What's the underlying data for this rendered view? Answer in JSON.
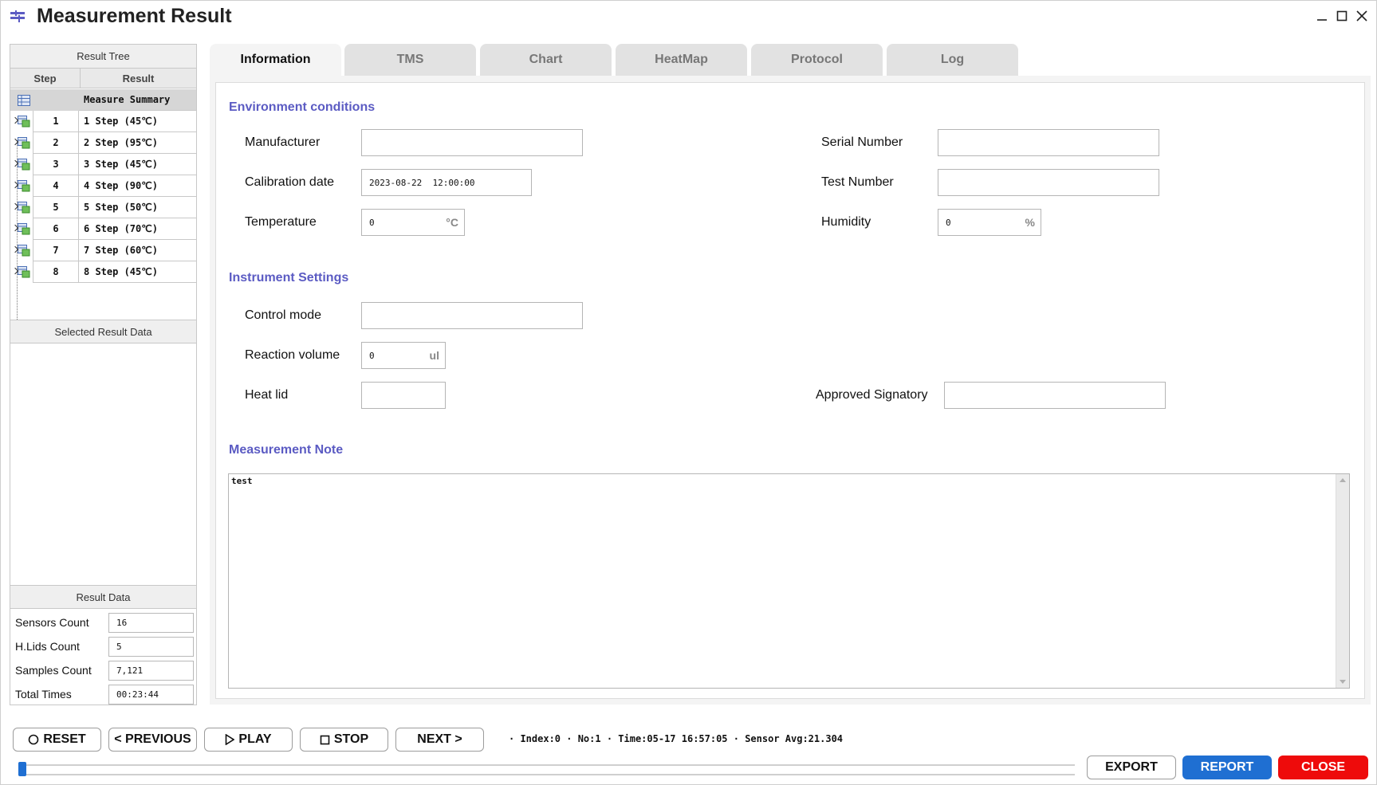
{
  "window": {
    "title": "Measurement Result"
  },
  "left_panel": {
    "result_tree_title": "Result Tree",
    "columns": {
      "step": "Step",
      "result": "Result"
    },
    "summary_label": "Measure Summary",
    "rows": [
      {
        "step": "1",
        "result": "1 Step (45℃)"
      },
      {
        "step": "2",
        "result": "2 Step (95℃)"
      },
      {
        "step": "3",
        "result": "3 Step (45℃)"
      },
      {
        "step": "4",
        "result": "4 Step (90℃)"
      },
      {
        "step": "5",
        "result": "5 Step (50℃)"
      },
      {
        "step": "6",
        "result": "6 Step (70℃)"
      },
      {
        "step": "7",
        "result": "7 Step (60℃)"
      },
      {
        "step": "8",
        "result": "8 Step (45℃)"
      }
    ],
    "selected_result_title": "Selected Result Data",
    "result_data_title": "Result Data",
    "result_data": {
      "sensors_label": "Sensors Count",
      "sensors_value": "16",
      "hlids_label": "H.Lids Count",
      "hlids_value": "5",
      "samples_label": "Samples Count",
      "samples_value": "7,121",
      "times_label": "Total Times",
      "times_value": "00:23:44"
    }
  },
  "tabs": [
    "Information",
    "TMS",
    "Chart",
    "HeatMap",
    "Protocol",
    "Log"
  ],
  "active_tab": "Information",
  "info": {
    "env_title": "Environment conditions",
    "manufacturer_label": "Manufacturer",
    "manufacturer_value": "",
    "serial_label": "Serial Number",
    "serial_value": "",
    "calibration_label": "Calibration date",
    "calibration_value": "2023-08-22  12:00:00",
    "test_number_label": "Test Number",
    "test_number_value": "",
    "temperature_label": "Temperature",
    "temperature_value": "0",
    "temperature_unit": "°C",
    "humidity_label": "Humidity",
    "humidity_value": "0",
    "humidity_unit": "%",
    "inst_title": "Instrument Settings",
    "control_label": "Control mode",
    "control_value": "",
    "reaction_label": "Reaction volume",
    "reaction_value": "0",
    "reaction_unit": "ul",
    "heatlid_label": "Heat lid",
    "heatlid_value": "",
    "signatory_label": "Approved Signatory",
    "signatory_value": "",
    "note_title": "Measurement Note",
    "note_value": "test"
  },
  "controls": {
    "reset": "RESET",
    "previous": "< PREVIOUS",
    "play": "PLAY",
    "stop": "STOP",
    "next": "NEXT >",
    "status": "· Index:0 · No:1 · Time:05-17 16:57:05 · Sensor Avg:21.304",
    "slider_fraction": 0.0,
    "export": "EXPORT",
    "report": "REPORT",
    "close": "CLOSE"
  },
  "colors": {
    "section": "#5b5bc3",
    "report_bg": "#1f6fd2",
    "close_bg": "#ee0b0b"
  }
}
